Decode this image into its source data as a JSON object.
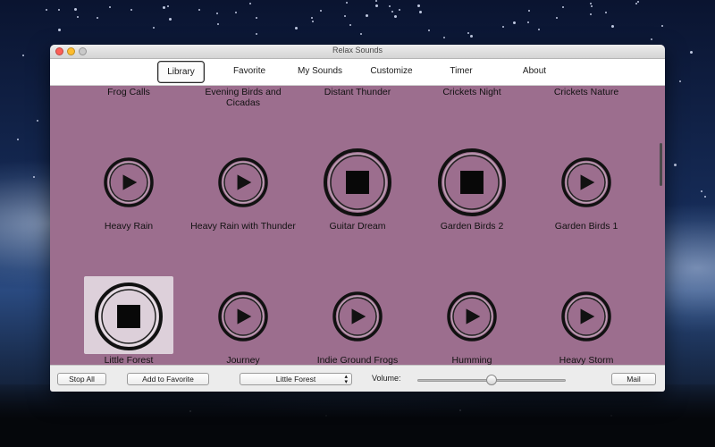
{
  "window": {
    "title": "Relax Sounds"
  },
  "tabs": [
    {
      "label": "Library",
      "active": true
    },
    {
      "label": "Favorite",
      "active": false
    },
    {
      "label": "My Sounds",
      "active": false
    },
    {
      "label": "Customize",
      "active": false
    },
    {
      "label": "Timer",
      "active": false
    },
    {
      "label": "About",
      "active": false
    }
  ],
  "top_row_labels": [
    "Frog Calls",
    "Evening Birds and Cicadas",
    "Distant Thunder",
    "Crickets Night",
    "Crickets Nature"
  ],
  "sounds": [
    {
      "label": "Heavy Rain",
      "state": "play"
    },
    {
      "label": "Heavy Rain with Thunder",
      "state": "play"
    },
    {
      "label": "Guitar Dream",
      "state": "stop"
    },
    {
      "label": "Garden Birds 2",
      "state": "stop"
    },
    {
      "label": "Garden Birds 1",
      "state": "play"
    },
    {
      "label": "Little Forest",
      "state": "stop",
      "selected": true
    },
    {
      "label": "Journey",
      "state": "play"
    },
    {
      "label": "Indie Ground Frogs",
      "state": "play"
    },
    {
      "label": "Humming",
      "state": "play"
    },
    {
      "label": "Heavy Storm",
      "state": "play"
    }
  ],
  "bottom": {
    "stop_all": "Stop All",
    "add_favorite": "Add to Favorite",
    "selected_sound": "Little Forest",
    "volume_label": "Volume:",
    "volume_fraction": 0.5,
    "mail": "Mail"
  },
  "colors": {
    "content_bg": "#9c6e8e",
    "selected_bg": "#ddd0da"
  },
  "icons": {
    "play": "play-icon",
    "stop": "stop-icon"
  }
}
